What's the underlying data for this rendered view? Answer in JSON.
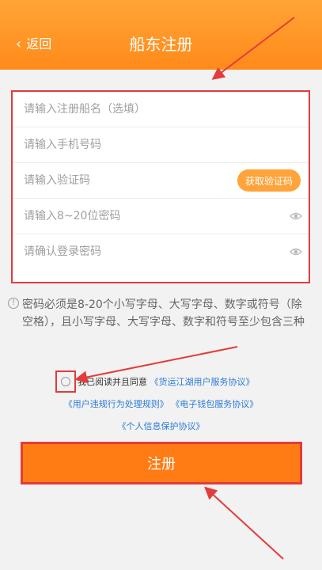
{
  "header": {
    "back_label": "返回",
    "title": "船东注册"
  },
  "form": {
    "ship_name_placeholder": "请输入注册船名（选填）",
    "phone_placeholder": "请输入手机号码",
    "code_placeholder": "请输入验证码",
    "get_code_label": "获取验证码",
    "password_placeholder": "请输入8~20位密码",
    "confirm_placeholder": "请确认登录密码"
  },
  "hint": {
    "text": "密码必须是8-20个小写字母、大写字母、数字或符号（除空格），且小写字母、大写字母、数字和符号至少包含三种"
  },
  "agreement": {
    "prefix": "我已阅读并且同意",
    "link1": "《货运江湖用户服务协议》",
    "link2": "《用户违规行为处理规则》",
    "link3": "《电子钱包服务协议》",
    "link4": "《个人信息保护协议》"
  },
  "submit_label": "注册",
  "colors": {
    "brand": "#ff8a1a",
    "link": "#2b7bd6",
    "annotation": "#e43b3b"
  },
  "icons": {
    "back": "chevron-left-icon",
    "eye": "eye-icon",
    "info": "info-icon",
    "checkbox": "radio-circle-icon"
  }
}
